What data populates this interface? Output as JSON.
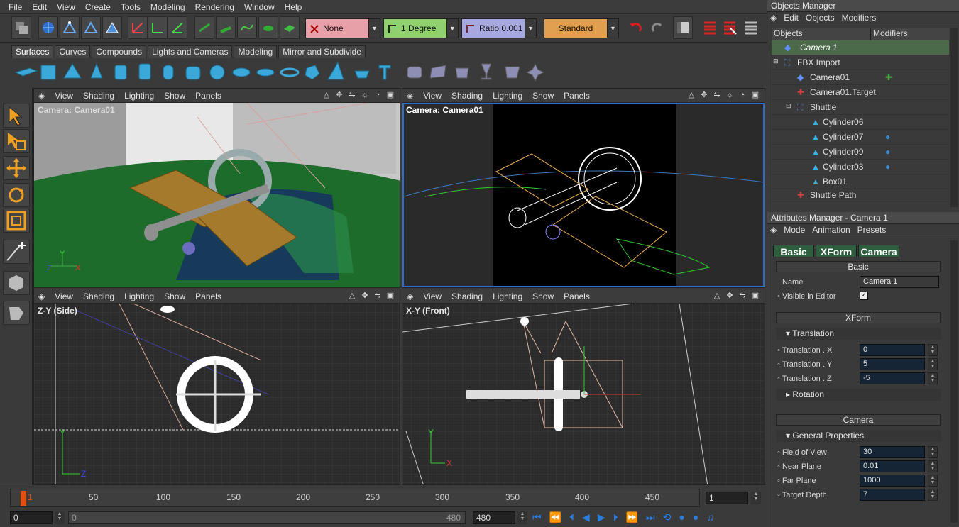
{
  "menubar": [
    "File",
    "Edit",
    "View",
    "Create",
    "Tools",
    "Modeling",
    "Rendering",
    "Window",
    "Help"
  ],
  "toolbar": {
    "snap": "None",
    "angle": "1 Degree",
    "ratio": "Ratio 0.001",
    "render": "Standard"
  },
  "shelf": {
    "tabs": [
      "Surfaces",
      "Curves",
      "Compounds",
      "Lights and Cameras",
      "Modeling",
      "Mirror and Subdivide"
    ],
    "active": "Surfaces"
  },
  "viewport_menu": [
    "View",
    "Shading",
    "Lighting",
    "Show",
    "Panels"
  ],
  "viewports": {
    "tl": "Camera: Camera01",
    "tr": "Camera: Camera01",
    "bl": "Z-Y (Side)",
    "br": "X-Y (Front)"
  },
  "timeline": {
    "ticks": [
      "1",
      "50",
      "100",
      "150",
      "200",
      "250",
      "300",
      "350",
      "400",
      "450"
    ],
    "current_frame": "1",
    "start": "0",
    "range_start": "0",
    "range_end": "480",
    "end": "480"
  },
  "objects_manager": {
    "title": "Objects Manager",
    "menu": [
      "Edit",
      "Objects",
      "Modifiers"
    ],
    "col_objects": "Objects",
    "col_modifiers": "Modifiers",
    "rows": [
      "Camera 1",
      "FBX Import",
      "Camera01",
      "Camera01.Target",
      "Shuttle",
      "Cylinder06",
      "Cylinder07",
      "Cylinder09",
      "Cylinder03",
      "Box01",
      "Shuttle Path"
    ]
  },
  "attributes_manager": {
    "title": "Attributes Manager - Camera 1",
    "menu": [
      "Mode",
      "Animation",
      "Presets"
    ],
    "tabs": [
      "Basic",
      "XForm",
      "Camera"
    ],
    "basic": {
      "header": "Basic",
      "name_label": "Name",
      "name": "Camera 1",
      "visible_label": "Visible in Editor"
    },
    "xform": {
      "header": "XForm",
      "translation": "Translation",
      "tx_label": "Translation . X",
      "tx": "0",
      "ty_label": "Translation . Y",
      "ty": "5",
      "tz_label": "Translation . Z",
      "tz": "-5",
      "rotation": "Rotation"
    },
    "camera": {
      "header": "Camera",
      "general": "General Properties",
      "fov_label": "Field of View",
      "fov": "30",
      "near_label": "Near Plane",
      "near": "0.01",
      "far_label": "Far Plane",
      "far": "1000",
      "depth_label": "Target Depth",
      "depth": "7"
    }
  },
  "colors": {
    "accent_green": "#2e5e3e",
    "snap_pink": "#e8a0a8",
    "angle_green": "#90d070",
    "ratio_purple": "#a8a8e0",
    "render_orange": "#e0a050"
  }
}
